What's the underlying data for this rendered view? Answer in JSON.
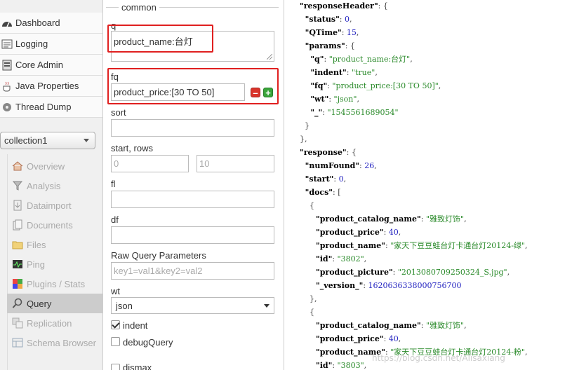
{
  "nav": {
    "top_items": [
      {
        "label": "Dashboard",
        "icon": "dashboard-icon"
      },
      {
        "label": "Logging",
        "icon": "logging-icon"
      },
      {
        "label": "Core Admin",
        "icon": "core-admin-icon"
      },
      {
        "label": "Java Properties",
        "icon": "java-properties-icon"
      },
      {
        "label": "Thread Dump",
        "icon": "thread-dump-icon"
      }
    ],
    "collection_selected": "collection1",
    "collection_items": [
      {
        "label": "Overview",
        "icon": "overview-icon"
      },
      {
        "label": "Analysis",
        "icon": "analysis-icon"
      },
      {
        "label": "Dataimport",
        "icon": "dataimport-icon"
      },
      {
        "label": "Documents",
        "icon": "documents-icon"
      },
      {
        "label": "Files",
        "icon": "files-icon"
      },
      {
        "label": "Ping",
        "icon": "ping-icon"
      },
      {
        "label": "Plugins / Stats",
        "icon": "plugins-icon"
      },
      {
        "label": "Query",
        "icon": "query-icon"
      },
      {
        "label": "Replication",
        "icon": "replication-icon"
      },
      {
        "label": "Schema Browser",
        "icon": "schema-browser-icon"
      }
    ],
    "active_item": "Query"
  },
  "form": {
    "legend": "common",
    "q_label": "q",
    "q_value": "product_name:台灯",
    "fq_label": "fq",
    "fq_value": "product_price:[30 TO 50]",
    "sort_label": "sort",
    "sort_value": "",
    "start_rows_label": "start, rows",
    "start_value": "0",
    "rows_value": "10",
    "fl_label": "fl",
    "fl_value": "",
    "df_label": "df",
    "df_value": "",
    "raw_label": "Raw Query Parameters",
    "raw_placeholder": "key1=val1&key2=val2",
    "wt_label": "wt",
    "wt_value": "json",
    "indent_label": "indent",
    "indent_checked": true,
    "debug_label": "debugQuery",
    "debug_checked": false,
    "dismax_label": "dismax"
  },
  "response_lines": [
    [
      {
        "t": "\"responseHeader\"",
        "c": "k"
      },
      {
        "t": ": {",
        "c": "p"
      }
    ],
    [
      {
        "t": "  \"status\"",
        "c": "k"
      },
      {
        "t": ": ",
        "c": "p"
      },
      {
        "t": "0",
        "c": "n"
      },
      {
        "t": ",",
        "c": "p"
      }
    ],
    [
      {
        "t": "  \"QTime\"",
        "c": "k"
      },
      {
        "t": ": ",
        "c": "p"
      },
      {
        "t": "15",
        "c": "n"
      },
      {
        "t": ",",
        "c": "p"
      }
    ],
    [
      {
        "t": "  \"params\"",
        "c": "k"
      },
      {
        "t": ": {",
        "c": "p"
      }
    ],
    [
      {
        "t": "    \"q\"",
        "c": "k"
      },
      {
        "t": ": ",
        "c": "p"
      },
      {
        "t": "\"product_name:台灯\"",
        "c": "s"
      },
      {
        "t": ",",
        "c": "p"
      }
    ],
    [
      {
        "t": "    \"indent\"",
        "c": "k"
      },
      {
        "t": ": ",
        "c": "p"
      },
      {
        "t": "\"true\"",
        "c": "s"
      },
      {
        "t": ",",
        "c": "p"
      }
    ],
    [
      {
        "t": "    \"fq\"",
        "c": "k"
      },
      {
        "t": ": ",
        "c": "p"
      },
      {
        "t": "\"product_price:[30 TO 50]\"",
        "c": "s"
      },
      {
        "t": ",",
        "c": "p"
      }
    ],
    [
      {
        "t": "    \"wt\"",
        "c": "k"
      },
      {
        "t": ": ",
        "c": "p"
      },
      {
        "t": "\"json\"",
        "c": "s"
      },
      {
        "t": ",",
        "c": "p"
      }
    ],
    [
      {
        "t": "    \"_\"",
        "c": "k"
      },
      {
        "t": ": ",
        "c": "p"
      },
      {
        "t": "\"1545561689054\"",
        "c": "s"
      }
    ],
    [
      {
        "t": "  }",
        "c": "p"
      }
    ],
    [
      {
        "t": "},",
        "c": "p"
      }
    ],
    [
      {
        "t": "\"response\"",
        "c": "k"
      },
      {
        "t": ": {",
        "c": "p"
      }
    ],
    [
      {
        "t": "  \"numFound\"",
        "c": "k"
      },
      {
        "t": ": ",
        "c": "p"
      },
      {
        "t": "26",
        "c": "n"
      },
      {
        "t": ",",
        "c": "p"
      }
    ],
    [
      {
        "t": "  \"start\"",
        "c": "k"
      },
      {
        "t": ": ",
        "c": "p"
      },
      {
        "t": "0",
        "c": "n"
      },
      {
        "t": ",",
        "c": "p"
      }
    ],
    [
      {
        "t": "  \"docs\"",
        "c": "k"
      },
      {
        "t": ": [",
        "c": "p"
      }
    ],
    [
      {
        "t": "    {",
        "c": "p"
      }
    ],
    [
      {
        "t": "      \"product_catalog_name\"",
        "c": "k"
      },
      {
        "t": ": ",
        "c": "p"
      },
      {
        "t": "\"雅致灯饰\"",
        "c": "s"
      },
      {
        "t": ",",
        "c": "p"
      }
    ],
    [
      {
        "t": "      \"product_price\"",
        "c": "k"
      },
      {
        "t": ": ",
        "c": "p"
      },
      {
        "t": "40",
        "c": "n"
      },
      {
        "t": ",",
        "c": "p"
      }
    ],
    [
      {
        "t": "      \"product_name\"",
        "c": "k"
      },
      {
        "t": ": ",
        "c": "p"
      },
      {
        "t": "\"家天下豆豆蛙台灯卡通台灯20124-绿\"",
        "c": "s"
      },
      {
        "t": ",",
        "c": "p"
      }
    ],
    [
      {
        "t": "      \"id\"",
        "c": "k"
      },
      {
        "t": ": ",
        "c": "p"
      },
      {
        "t": "\"3802\"",
        "c": "s"
      },
      {
        "t": ",",
        "c": "p"
      }
    ],
    [
      {
        "t": "      \"product_picture\"",
        "c": "k"
      },
      {
        "t": ": ",
        "c": "p"
      },
      {
        "t": "\"2013080709250324_S.jpg\"",
        "c": "s"
      },
      {
        "t": ",",
        "c": "p"
      }
    ],
    [
      {
        "t": "      \"_version_\"",
        "c": "k"
      },
      {
        "t": ": ",
        "c": "p"
      },
      {
        "t": "1620636338000756700",
        "c": "n"
      }
    ],
    [
      {
        "t": "    },",
        "c": "p"
      }
    ],
    [
      {
        "t": "    {",
        "c": "p"
      }
    ],
    [
      {
        "t": "      \"product_catalog_name\"",
        "c": "k"
      },
      {
        "t": ": ",
        "c": "p"
      },
      {
        "t": "\"雅致灯饰\"",
        "c": "s"
      },
      {
        "t": ",",
        "c": "p"
      }
    ],
    [
      {
        "t": "      \"product_price\"",
        "c": "k"
      },
      {
        "t": ": ",
        "c": "p"
      },
      {
        "t": "40",
        "c": "n"
      },
      {
        "t": ",",
        "c": "p"
      }
    ],
    [
      {
        "t": "      \"product_name\"",
        "c": "k"
      },
      {
        "t": ": ",
        "c": "p"
      },
      {
        "t": "\"家天下豆豆蛙台灯卡通台灯20124-粉\"",
        "c": "s"
      },
      {
        "t": ",",
        "c": "p"
      }
    ],
    [
      {
        "t": "      \"id\"",
        "c": "k"
      },
      {
        "t": ": ",
        "c": "p"
      },
      {
        "t": "\"3803\"",
        "c": "s"
      },
      {
        "t": ",",
        "c": "p"
      }
    ]
  ],
  "watermark": "https://blog.csdn.net/Alisaxiang"
}
